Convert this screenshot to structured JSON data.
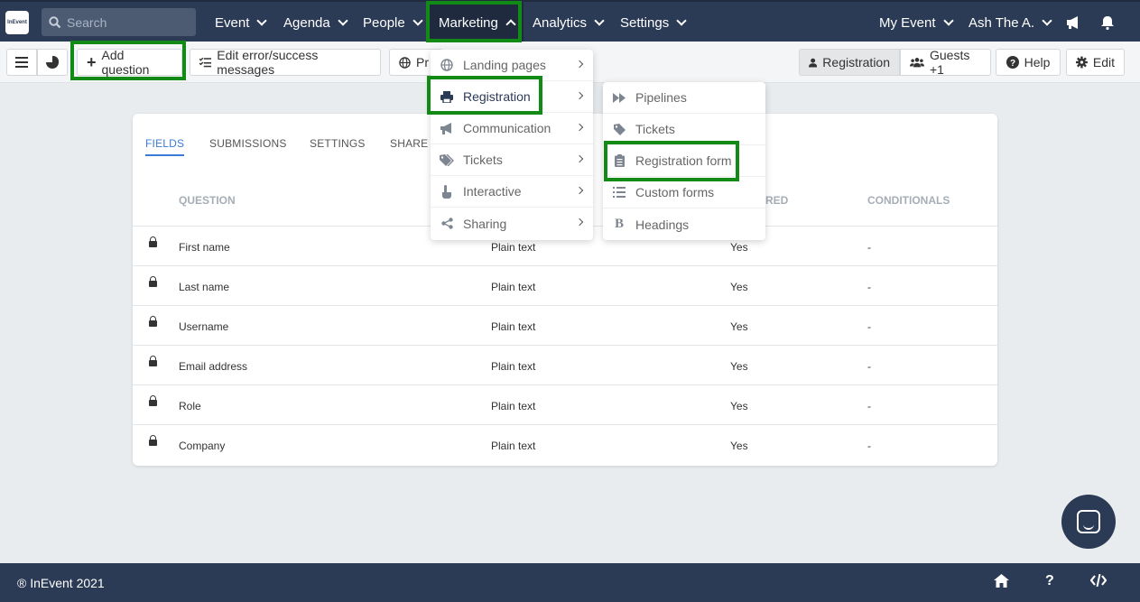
{
  "topnav": {
    "search_placeholder": "Search",
    "logo_text": "InEvent",
    "items": [
      "Event",
      "Agenda",
      "People",
      "Marketing",
      "Analytics",
      "Settings"
    ],
    "right_items": [
      "My Event",
      "Ash The A."
    ]
  },
  "toolbar": {
    "add_question": "Add question",
    "edit_messages": "Edit error/success messages",
    "preview_partial": "Pr",
    "registration": "Registration",
    "guests": "Guests +1",
    "help": "Help",
    "edit": "Edit"
  },
  "card": {
    "tabs": [
      "FIELDS",
      "SUBMISSIONS",
      "SETTINGS",
      "SHARE"
    ],
    "columns": [
      "QUESTION",
      "RED",
      "CONDITIONALS"
    ],
    "rows": [
      {
        "question": "First name",
        "type": "Plain text",
        "required": "Yes",
        "conditionals": "-"
      },
      {
        "question": "Last name",
        "type": "Plain text",
        "required": "Yes",
        "conditionals": "-"
      },
      {
        "question": "Username",
        "type": "Plain text",
        "required": "Yes",
        "conditionals": "-"
      },
      {
        "question": "Email address",
        "type": "Plain text",
        "required": "Yes",
        "conditionals": "-"
      },
      {
        "question": "Role",
        "type": "Plain text",
        "required": "Yes",
        "conditionals": "-"
      },
      {
        "question": "Company",
        "type": "Plain text",
        "required": "Yes",
        "conditionals": "-"
      }
    ]
  },
  "marketing_menu": {
    "items": [
      {
        "label": "Landing pages",
        "icon": "globe-icon"
      },
      {
        "label": "Registration",
        "icon": "printer-icon"
      },
      {
        "label": "Communication",
        "icon": "megaphone-icon"
      },
      {
        "label": "Tickets",
        "icon": "tags-icon"
      },
      {
        "label": "Interactive",
        "icon": "hand-pointer-icon"
      },
      {
        "label": "Sharing",
        "icon": "share-icon"
      }
    ]
  },
  "registration_submenu": {
    "items": [
      {
        "label": "Pipelines",
        "icon": "fast-forward-icon"
      },
      {
        "label": "Tickets",
        "icon": "tag-icon"
      },
      {
        "label": "Registration form",
        "icon": "clipboard-icon"
      },
      {
        "label": "Custom forms",
        "icon": "list-icon"
      },
      {
        "label": "Headings",
        "icon": "bold-icon"
      }
    ]
  },
  "footer": {
    "copyright": "® InEvent 2021"
  },
  "colors": {
    "navbar": "#2b3a55",
    "highlight": "#128a16",
    "accent": "#3a7bd5"
  }
}
